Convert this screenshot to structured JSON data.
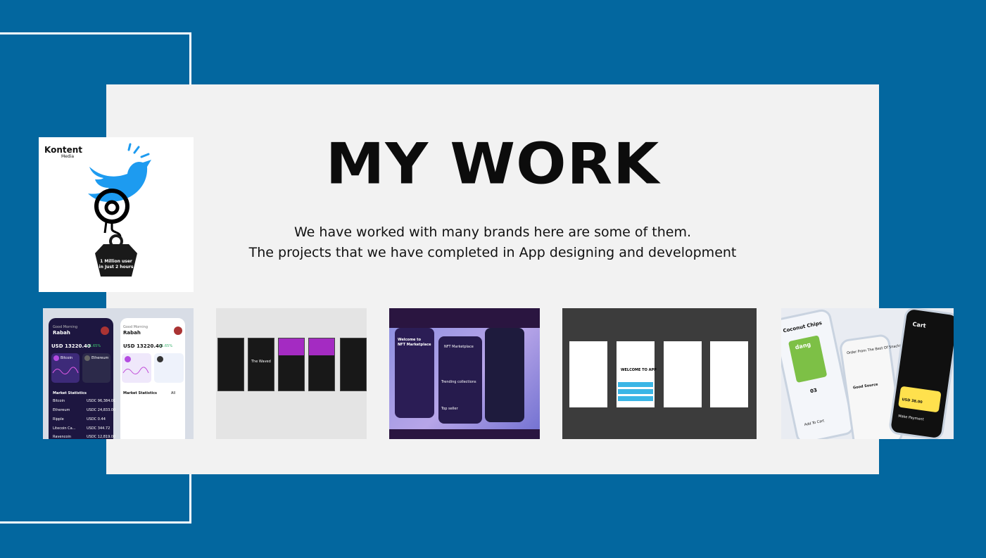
{
  "title": "MY WORK",
  "subtitle": {
    "line1": "We have worked with many brands here are some of them.",
    "line2": "The projects that we have completed in App designing and development"
  },
  "colors": {
    "background": "#03679f",
    "card": "#f2f2f2",
    "outline": "#ffffff"
  },
  "portfolio": {
    "logo_tile": {
      "brand": "Kontent",
      "brand_sub": "Media",
      "badge_line1": "1 Million user",
      "badge_line2": "in Just 2 hours"
    },
    "crypto_app": {
      "greeting": "Good Morning",
      "user": "Rabah",
      "balance": "USD 13220.40",
      "change": "+1.65%",
      "coins": [
        "Bitcoin",
        "Ethereum"
      ],
      "section": "Market Statistics",
      "section_link": "All",
      "rows": [
        {
          "name": "Bitcoin",
          "value": "USDC 96,384.01"
        },
        {
          "name": "Ethereum",
          "value": "USDC 24,833.00"
        },
        {
          "name": "Ripple",
          "value": "USDC 0.44"
        },
        {
          "name": "Litecoin Ca...",
          "value": "USDC 344.72"
        },
        {
          "name": "Ravencoin",
          "value": "USDC 12,819.00"
        }
      ]
    },
    "music_app": {
      "app_name": "The Waved"
    },
    "nft_app": {
      "headline_line1": "Welcome to",
      "headline_line2": "NFT Marketplace",
      "screen_title": "NFT Marketplace",
      "section_label": "Trending collections",
      "sub_label": "Top seller"
    },
    "welcome_app": {
      "welcome_label": "WELCOME TO APP"
    },
    "snack_app": {
      "product": "Coconut Chips",
      "brand_pack": "dang",
      "headline": "Order From The Best Of Snacks",
      "card_label": "Good Source",
      "price": "USD 38.00",
      "qty": "03",
      "cart_title": "Cart",
      "pay_button": "Make Payment",
      "add_button": "Add To Cart"
    }
  }
}
